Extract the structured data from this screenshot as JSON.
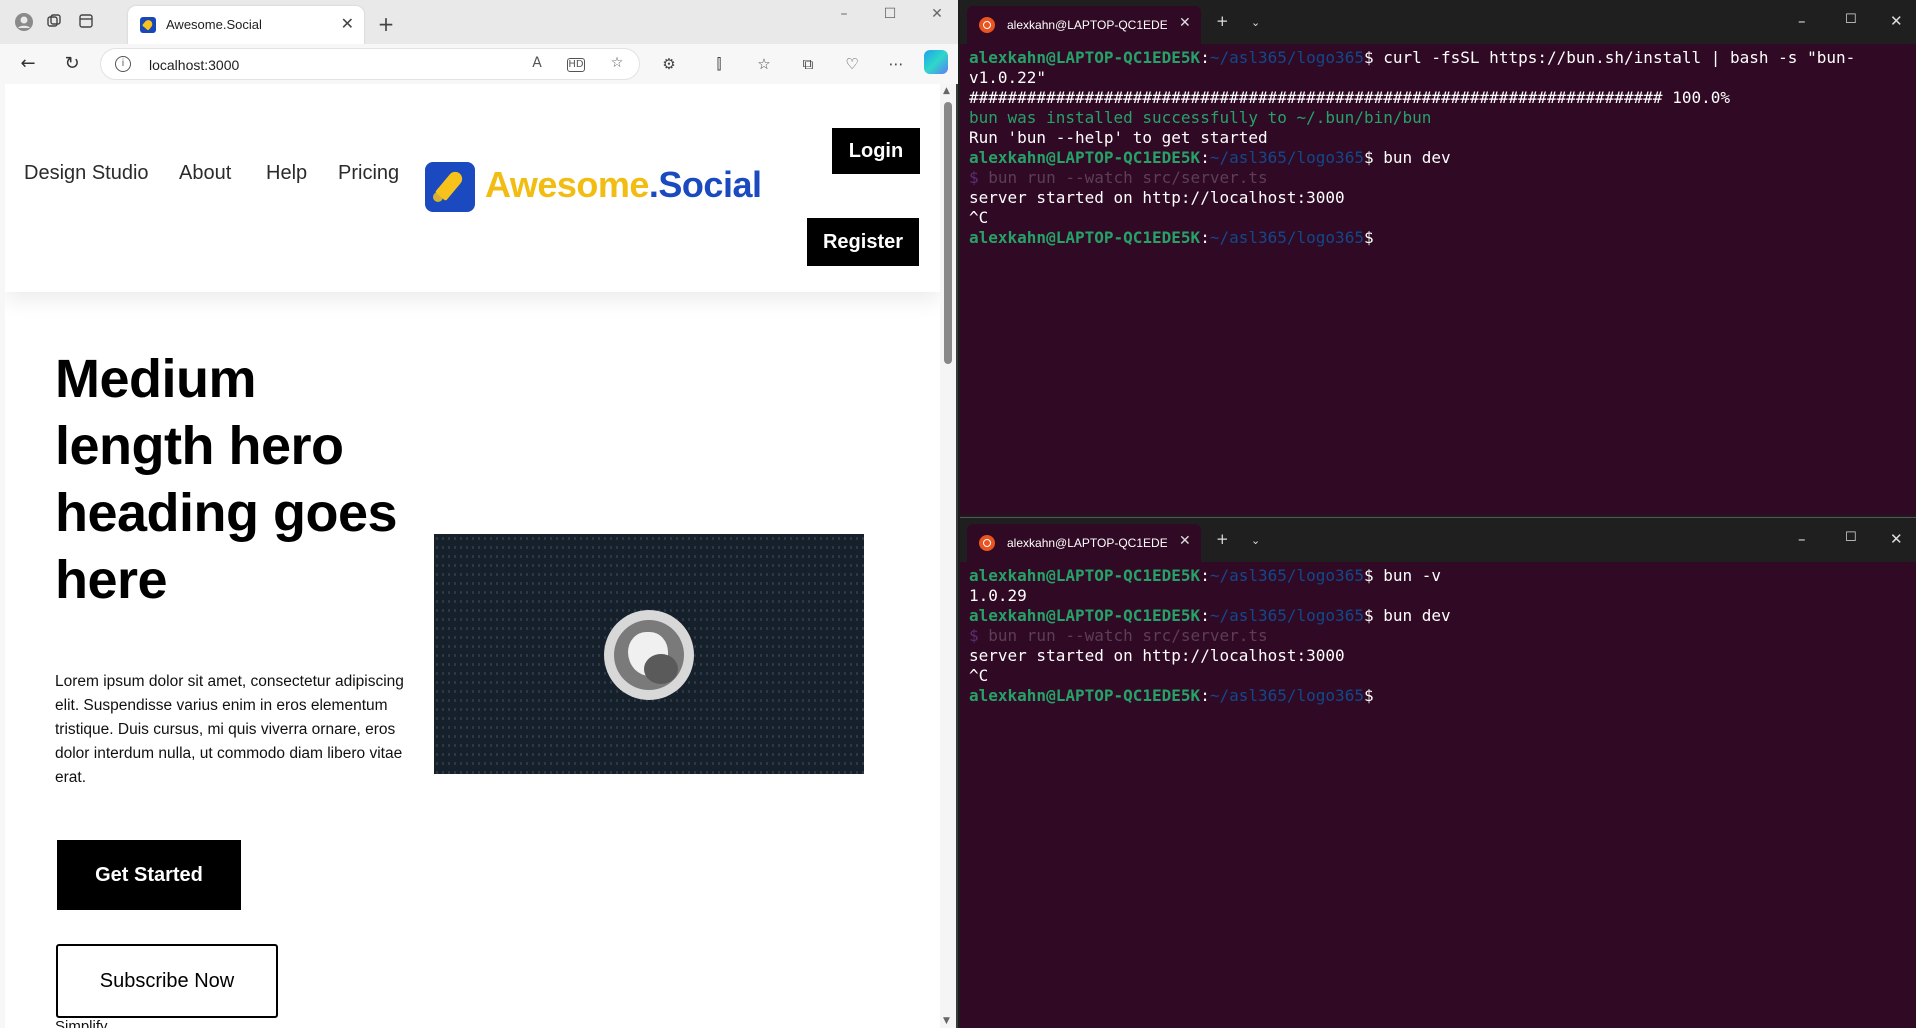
{
  "browser": {
    "tab_title": "Awesome.Social",
    "url": "localhost:3000",
    "new_tab_glyph": "+",
    "close_glyph": "✕"
  },
  "site": {
    "nav": [
      "Design Studio",
      "About",
      "Help",
      "Pricing"
    ],
    "logo": {
      "part1": "Awesome",
      "part2": ".Social"
    },
    "login": "Login",
    "register": "Register",
    "hero_heading": "Medium length hero heading goes here",
    "hero_paragraph": "Lorem ipsum dolor sit amet, consectetur adipiscing elit. Suspendisse varius enim in eros elementum tristique. Duis cursus, mi quis viverra ornare, eros dolor interdum nulla, ut commodo diam libero vitae erat.",
    "get_started": "Get Started",
    "subscribe": "Subscribe Now",
    "simplify": "Simplify"
  },
  "colors": {
    "logo_yellow": "#f2bd12",
    "logo_blue": "#1b49c0",
    "terminal_bg": "#300a24",
    "prompt_green": "#26a269",
    "prompt_path": "#12488b"
  },
  "terminal_top": {
    "tab_title": "alexkahn@LAPTOP-QC1EDE5K",
    "prompt_user": "alexkahn@LAPTOP-QC1EDE5K",
    "prompt_path": "~/asl365/logo365",
    "lines": [
      {
        "kind": "prompt",
        "cmd": "curl -fsSL https://bun.sh/install | bash -s \"bun-"
      },
      {
        "kind": "text",
        "text": "v1.0.22\""
      },
      {
        "kind": "text",
        "text": "######################################################################## 100.0%"
      },
      {
        "kind": "green",
        "text": "bun was installed successfully to ~/.bun/bin/bun"
      },
      {
        "kind": "text",
        "text": "Run 'bun --help' to get started"
      },
      {
        "kind": "prompt",
        "cmd": "bun dev"
      },
      {
        "kind": "dim",
        "text": "bun run --watch src/server.ts"
      },
      {
        "kind": "text",
        "text": "server started on http://localhost:3000"
      },
      {
        "kind": "text",
        "text": "^C"
      },
      {
        "kind": "prompt",
        "cmd": ""
      }
    ]
  },
  "terminal_bottom": {
    "tab_title": "alexkahn@LAPTOP-QC1EDE5K",
    "prompt_user": "alexkahn@LAPTOP-QC1EDE5K",
    "prompt_path": "~/asl365/logo365",
    "lines": [
      {
        "kind": "prompt",
        "cmd": "bun -v"
      },
      {
        "kind": "text",
        "text": "1.0.29"
      },
      {
        "kind": "prompt",
        "cmd": "bun dev"
      },
      {
        "kind": "dim",
        "text": "bun run --watch src/server.ts"
      },
      {
        "kind": "text",
        "text": "server started on http://localhost:3000"
      },
      {
        "kind": "text",
        "text": "^C"
      },
      {
        "kind": "prompt",
        "cmd": ""
      }
    ]
  }
}
